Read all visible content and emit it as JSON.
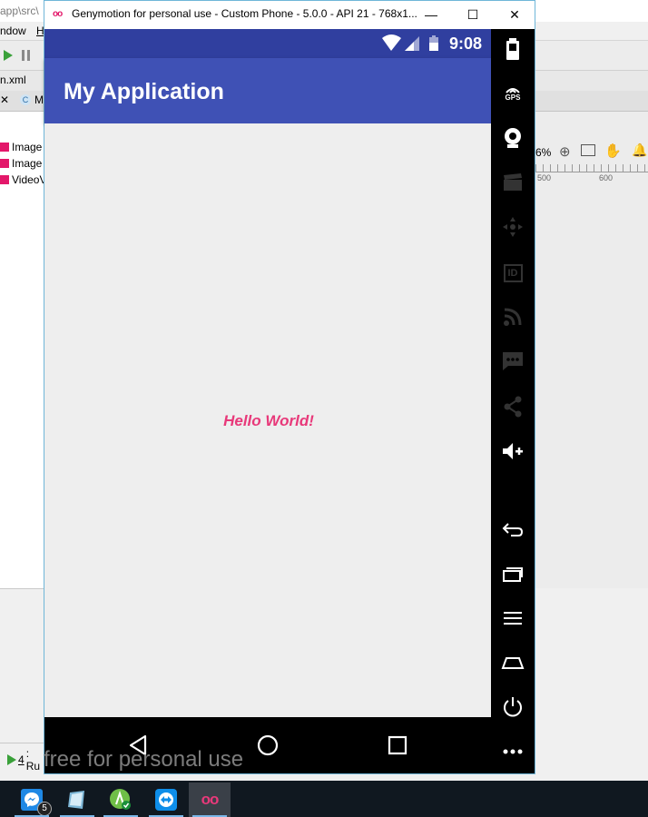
{
  "ide": {
    "title_path": "app\\src\\",
    "menu": [
      "ndow",
      "H"
    ],
    "file_tab": "n.xml",
    "class_tab": "M",
    "palette": [
      "Image",
      "Image",
      "VideoV"
    ],
    "zoom": "6%",
    "ruler": [
      "500",
      "600"
    ],
    "run_tab_num": "4",
    "run_tab_label": ": Ru"
  },
  "genymotion": {
    "window_title": "Genymotion for personal use - Custom Phone - 5.0.0 - API 21 - 768x1...",
    "logo": "oo",
    "minimize": "—",
    "maximize": "☐",
    "close": "✕",
    "watermark": "free for personal use",
    "sidebar": {
      "gps_label": "GPS",
      "id_label": "ID"
    }
  },
  "phone": {
    "clock": "9:08",
    "app_title": "My Application",
    "content_text": "Hello World!"
  },
  "taskbar": {
    "messenger_badge": "5",
    "genymotion_logo": "oo"
  },
  "colors": {
    "primary": "#3f51b5",
    "primary_dark": "#303f9f",
    "accent_text": "#e8397a",
    "screen_bg": "#eeeeee"
  }
}
